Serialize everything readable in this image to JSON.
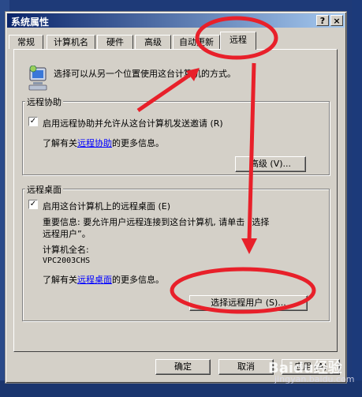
{
  "window": {
    "title": "系统属性",
    "help_btn": "?",
    "close_btn": "×"
  },
  "tabs": [
    {
      "label": "常规"
    },
    {
      "label": "计算机名"
    },
    {
      "label": "硬件"
    },
    {
      "label": "高级"
    },
    {
      "label": "自动更新"
    },
    {
      "label": "远程"
    }
  ],
  "active_tab": "远程",
  "intro_text": "选择可以从另一个位置使用这台计算机的方式。",
  "remote_assistance": {
    "legend": "远程协助",
    "checkbox_label": "启用远程协助并允许从这台计算机发送邀请 (R)",
    "checked": true,
    "learn_prefix": "了解有关",
    "learn_link": "远程协助",
    "learn_suffix": "的更多信息。",
    "advanced_button": "高级 (V)..."
  },
  "remote_desktop": {
    "legend": "远程桌面",
    "checkbox_label": "启用这台计算机上的远程桌面 (E)",
    "checked": true,
    "important_line1": "重要信息: 要允许用户远程连接到这台计算机, 请单击 “选择",
    "important_line2": "远程用户”。",
    "full_name_label": "计算机全名:",
    "full_name_value": "VPC2003CHS",
    "learn_prefix": "了解有关",
    "learn_link": "远程桌面",
    "learn_suffix": "的更多信息。",
    "select_users_button": "选择远程用户 (S)..."
  },
  "buttons": {
    "ok": "确定",
    "cancel": "取消",
    "apply": "应用 (A)"
  },
  "watermark": {
    "brand": "Baidu经验",
    "url": "jingyan.baidu.com"
  },
  "colors": {
    "annotation_red": "#e8202a",
    "titlebar": "#0a246a",
    "dialog_face": "#d4d0c8",
    "link": "#0000ff"
  }
}
